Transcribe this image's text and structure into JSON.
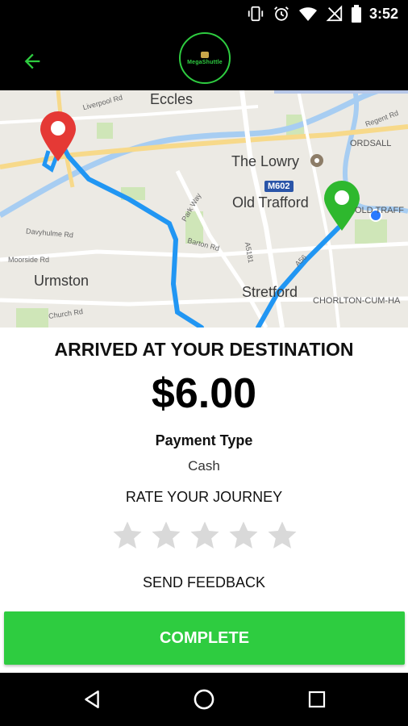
{
  "status_bar": {
    "time": "3:52",
    "icons": [
      "vibrate-icon",
      "alarm-icon",
      "wifi-icon",
      "no-signal-icon",
      "battery-icon"
    ]
  },
  "app_bar": {
    "back_icon": "arrow-back-icon",
    "logo_text": "MegaShuttle"
  },
  "map": {
    "labels": {
      "eccles": "Eccles",
      "the_lowry": "The Lowry",
      "old_trafford": "Old Trafford",
      "urmston": "Urmston",
      "stretford": "Stretford",
      "ordsall": "ORDSALL",
      "old_traff": "OLD TRAFF",
      "chorlton": "CHORLTON-CUM-HA",
      "m602": "M602",
      "liverpool_rd": "Liverpool Rd",
      "regent_rd": "Regent Rd",
      "park_way": "Park Way",
      "barton_rd": "Barton Rd",
      "a5181": "A5181",
      "a56": "A56",
      "davyhulme_rd": "Davyhulme Rd",
      "moorside_rd": "Moorside Rd",
      "church_rd": "Church Rd"
    },
    "colors": {
      "route": "#2196f3",
      "origin_pin": "#e53935",
      "destination_pin": "#2eb82e",
      "current_location": "#2979ff"
    }
  },
  "trip": {
    "title": "ARRIVED AT YOUR DESTINATION",
    "fare": "$6.00",
    "payment_label": "Payment Type",
    "payment_value": "Cash",
    "rate_label": "RATE YOUR JOURNEY",
    "rating": 0,
    "max_rating": 5,
    "feedback_label": "SEND FEEDBACK"
  },
  "actions": {
    "complete_label": "COMPLETE"
  },
  "colors": {
    "accent": "#2ecc40",
    "bar_bg": "#000000",
    "star_empty": "#d9d9d9"
  },
  "nav": {
    "back": "nav-back-icon",
    "home": "nav-home-icon",
    "recents": "nav-recents-icon"
  }
}
